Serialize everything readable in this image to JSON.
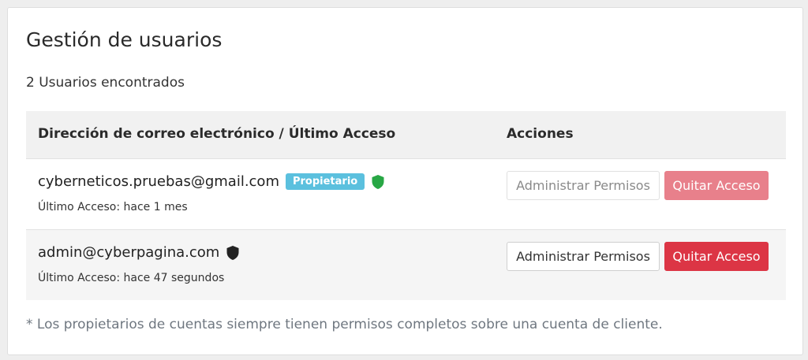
{
  "panel": {
    "title": "Gestión de usuarios",
    "count_text": "2 Usuarios encontrados"
  },
  "table": {
    "headers": {
      "email": "Dirección de correo electrónico / Último Acceso",
      "actions": "Acciones"
    },
    "rows": [
      {
        "email": "cyberneticos.pruebas@gmail.com",
        "badge": "Propietario",
        "shield_icon": "green-shield-icon",
        "last_access": "Último Acceso: hace 1 mes",
        "manage_label": "Administrar Permisos",
        "revoke_label": "Quitar Acceso",
        "actions_disabled": true
      },
      {
        "email": "admin@cyberpagina.com",
        "shield_icon": "black-shield-icon",
        "last_access": "Último Acceso: hace 47 segundos",
        "manage_label": "Administrar Permisos",
        "revoke_label": "Quitar Acceso",
        "actions_disabled": false
      }
    ]
  },
  "footnote": "* Los propietarios de cuentas siempre tienen permisos completos sobre una cuenta de cliente.",
  "colors": {
    "badge": "#5bc0de",
    "danger": "#dc3545",
    "danger_disabled": "#e8808b",
    "shield_green": "#28a745",
    "shield_black": "#222222"
  }
}
